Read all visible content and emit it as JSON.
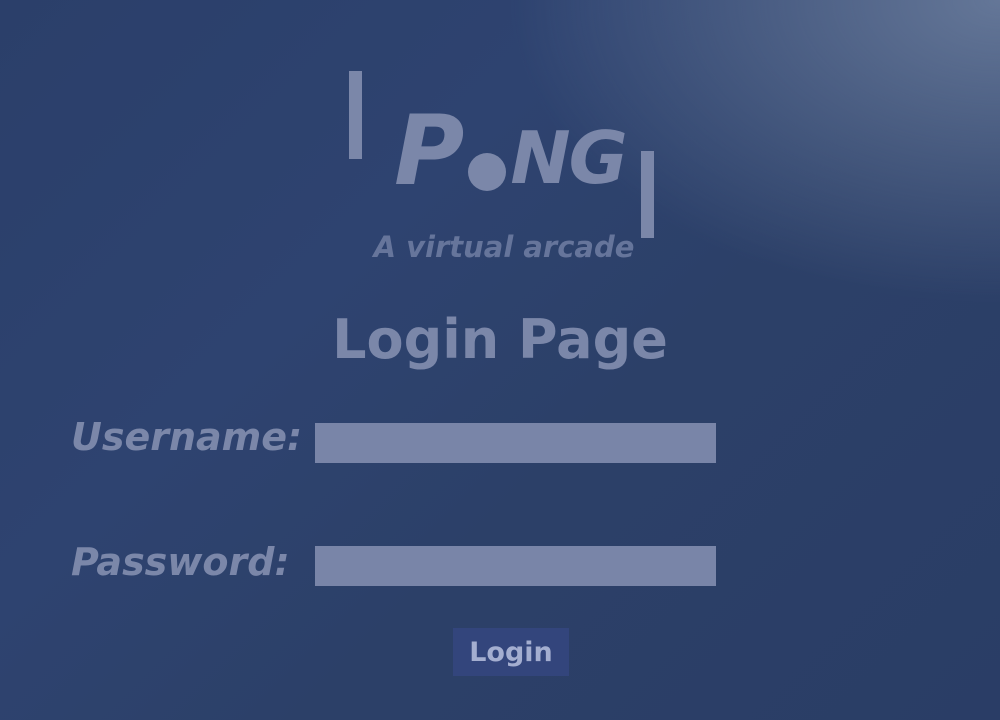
{
  "logo": {
    "letter_p": "P",
    "letters_ng": "NG"
  },
  "tagline": "A virtual arcade",
  "page_title": "Login Page",
  "form": {
    "username_label": "Username:",
    "username_value": "",
    "password_label": "Password:",
    "password_value": "",
    "login_label": "Login"
  },
  "colors": {
    "background": "#2c4068",
    "accent": "#7b87a9",
    "input_fill": "#7985a8",
    "button_fill": "#33457c"
  }
}
